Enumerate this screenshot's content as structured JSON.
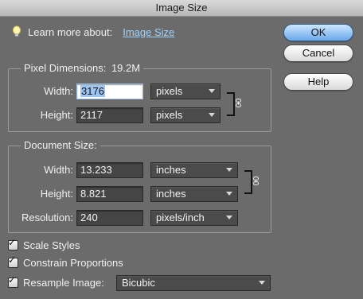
{
  "window": {
    "title": "Image Size"
  },
  "learn": {
    "label": "Learn more about:",
    "link": "Image Size",
    "icon": "lightbulb-icon"
  },
  "buttons": {
    "ok": "OK",
    "cancel": "Cancel",
    "help": "Help"
  },
  "pixel_dimensions": {
    "legend": "Pixel Dimensions:",
    "size": "19.2M",
    "width": {
      "label": "Width:",
      "value": "3176",
      "unit": "pixels"
    },
    "height": {
      "label": "Height:",
      "value": "2117",
      "unit": "pixels"
    }
  },
  "document_size": {
    "legend": "Document Size:",
    "width": {
      "label": "Width:",
      "value": "13.233",
      "unit": "inches"
    },
    "height": {
      "label": "Height:",
      "value": "8.821",
      "unit": "inches"
    },
    "resolution": {
      "label": "Resolution:",
      "value": "240",
      "unit": "pixels/inch"
    }
  },
  "options": {
    "scale_styles": {
      "label": "Scale Styles",
      "checked": true
    },
    "constrain_proportions": {
      "label": "Constrain Proportions",
      "checked": true
    },
    "resample": {
      "label": "Resample Image:",
      "checked": true,
      "method": "Bicubic"
    }
  },
  "colors": {
    "dialog_bg": "#6b6b6b",
    "link": "#9fd3ff",
    "ok_button": "#6aa8ea"
  }
}
